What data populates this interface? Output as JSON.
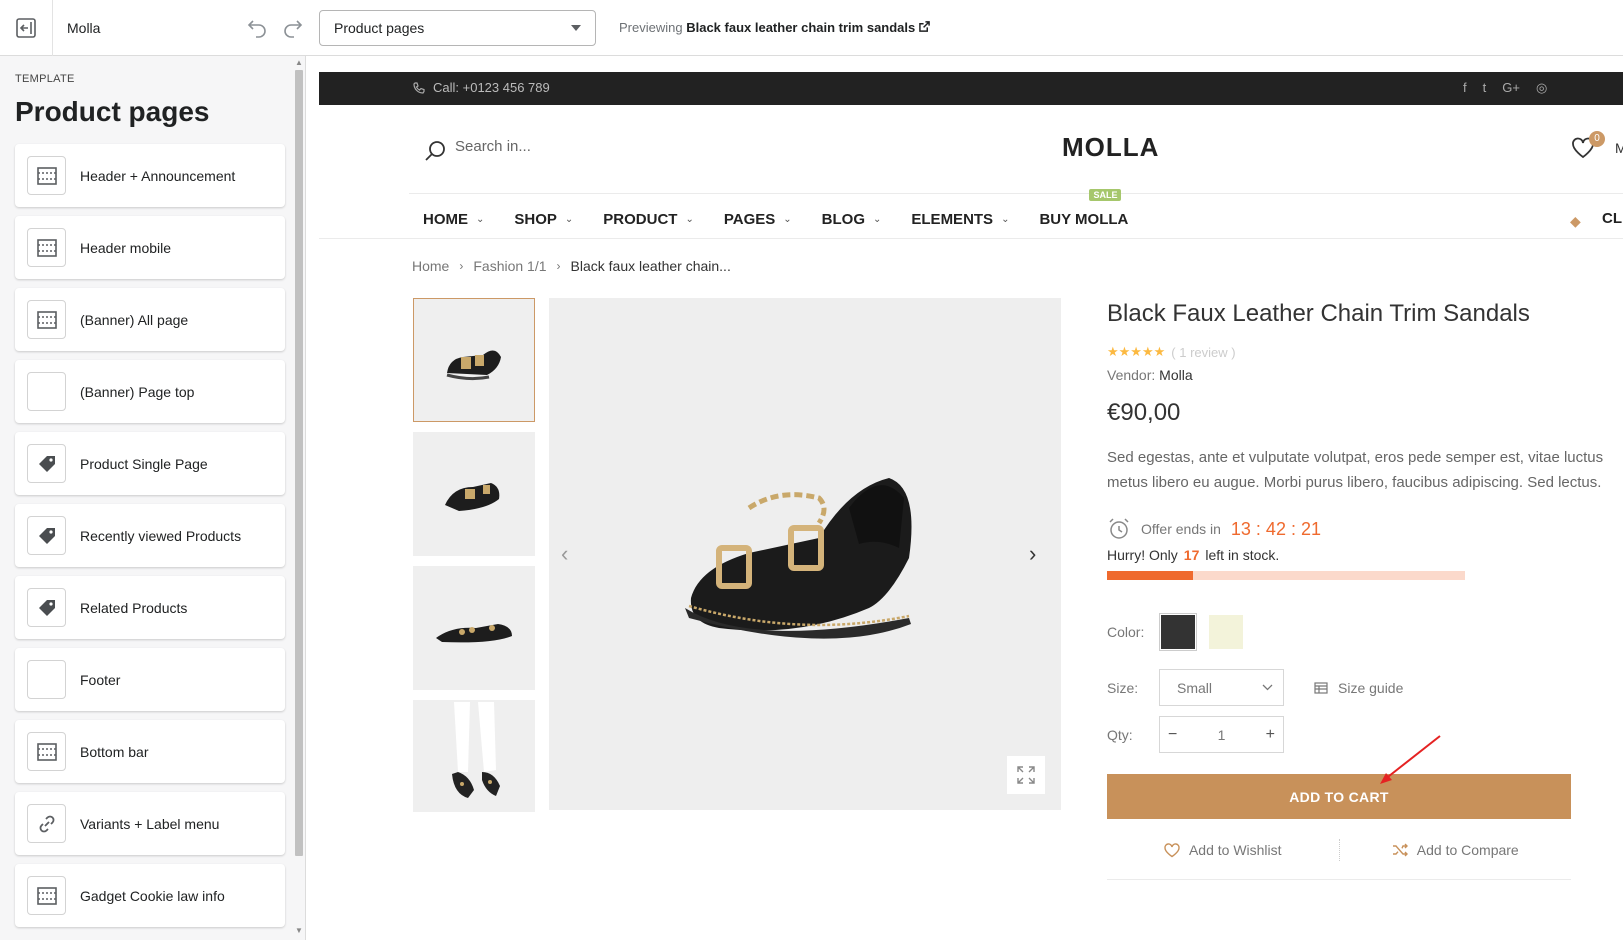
{
  "editor": {
    "theme_name": "Molla",
    "template_select": "Product pages",
    "preview_prefix": "Previewing",
    "preview_product": "Black faux leather chain trim sandals"
  },
  "sidebar": {
    "eyebrow": "TEMPLATE",
    "title": "Product pages",
    "items": [
      {
        "label": "Header + Announcement",
        "icon": "layout-section-icon"
      },
      {
        "label": "Header mobile",
        "icon": "layout-section-icon"
      },
      {
        "label": "(Banner) All page",
        "icon": "layout-section-icon"
      },
      {
        "label": "(Banner) Page top",
        "icon": "blank-icon"
      },
      {
        "label": "Product Single Page",
        "icon": "tag-icon"
      },
      {
        "label": "Recently viewed Products",
        "icon": "tag-icon"
      },
      {
        "label": "Related Products",
        "icon": "tag-icon"
      },
      {
        "label": "Footer",
        "icon": "blank-icon"
      },
      {
        "label": "Bottom bar",
        "icon": "layout-section-icon"
      },
      {
        "label": "Variants + Label menu",
        "icon": "link-icon"
      },
      {
        "label": "Gadget Cookie law info",
        "icon": "layout-section-icon"
      }
    ]
  },
  "store": {
    "call": "Call: +0123 456 789",
    "social_icons": [
      "facebook-icon",
      "twitter-icon",
      "google-plus-icon",
      "instagram-icon"
    ],
    "search_placeholder": "Search in...",
    "logo": "MOLLA",
    "wishlist_count": "0",
    "header_right_text": "M",
    "nav": [
      {
        "label": "HOME",
        "dropdown": true
      },
      {
        "label": "SHOP",
        "dropdown": true
      },
      {
        "label": "PRODUCT",
        "dropdown": true
      },
      {
        "label": "PAGES",
        "dropdown": true
      },
      {
        "label": "BLOG",
        "dropdown": true
      },
      {
        "label": "ELEMENTS",
        "dropdown": true
      },
      {
        "label": "BUY MOLLA",
        "dropdown": false
      }
    ],
    "sale_badge": "SALE",
    "nav_right": "CL",
    "breadcrumb": [
      "Home",
      "Fashion 1/1",
      "Black faux leather chain..."
    ]
  },
  "product": {
    "title": "Black Faux Leather Chain Trim Sandals",
    "stars": "★★★★★",
    "rating": 5,
    "review_count": "( 1 review )",
    "vendor_label": "Vendor:",
    "vendor": "Molla",
    "price": "€90,00",
    "description": "Sed egestas, ante et vulputate volutpat, eros pede semper est, vitae luctus metus libero eu augue. Morbi purus libero, faucibus adipiscing. Sed lectus.",
    "offer_label": "Offer ends in",
    "countdown": "13 : 42 : 21",
    "hurry_prefix": "Hurry! Only",
    "stock_left": "17",
    "hurry_suffix": "left in stock.",
    "stock_fraction": 0.24,
    "color_label": "Color:",
    "colors": [
      "#333333",
      "#f3f3da"
    ],
    "size_label": "Size:",
    "size_value": "Small",
    "size_guide": "Size guide",
    "qty_label": "Qty:",
    "qty_value": "1",
    "add_to_cart": "ADD TO CART",
    "add_to_wishlist": "Add to Wishlist",
    "add_to_compare": "Add to Compare"
  },
  "colors": {
    "accent": "#c8915a",
    "countdown": "#ef6a2e",
    "sale_badge": "#a6c76c",
    "stars": "#fcb941"
  }
}
